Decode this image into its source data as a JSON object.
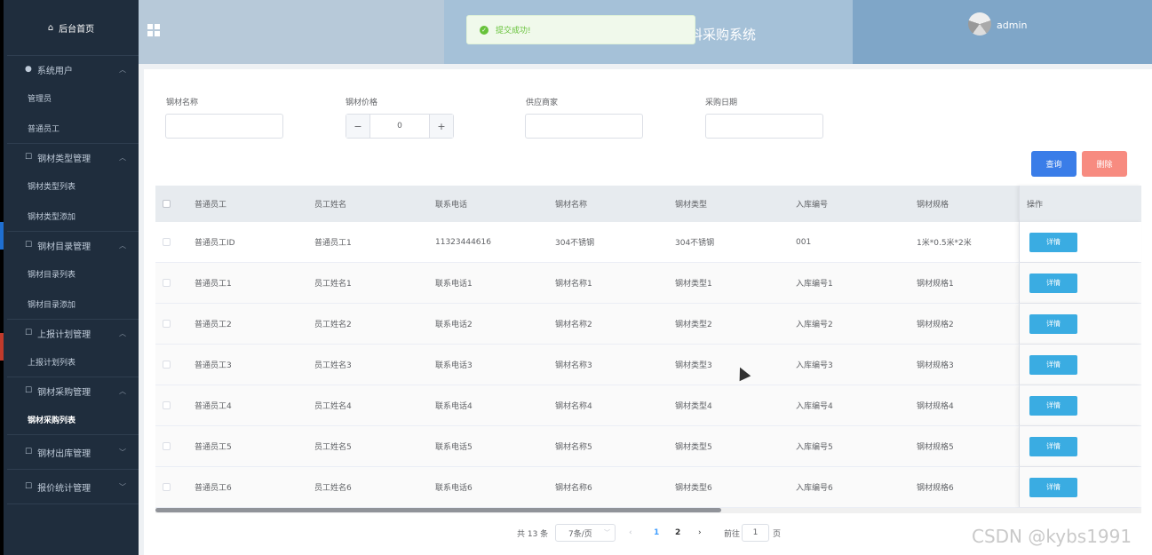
{
  "sidebar": {
    "home": "后台首页",
    "groups": [
      {
        "label": "系统用户",
        "items": [
          "管理员",
          "普通员工"
        ]
      },
      {
        "label": "钢材类型管理",
        "items": [
          "钢材类型列表",
          "钢材类型添加"
        ]
      },
      {
        "label": "钢材目录管理",
        "items": [
          "钢材目录列表",
          "钢材目录添加"
        ]
      },
      {
        "label": "上报计划管理",
        "items": [
          "上报计划列表"
        ]
      },
      {
        "label": "钢材采购管理",
        "items": [
          "钢材采购列表"
        ]
      },
      {
        "label": "钢材出库管理",
        "items": []
      },
      {
        "label": "报价统计管理",
        "items": []
      }
    ]
  },
  "header": {
    "title": "料采购系统",
    "username": "admin"
  },
  "toast": {
    "message": "提交成功!",
    "type": "success"
  },
  "filters": {
    "name_label": "钢材名称",
    "name_value": "",
    "price_label": "钢材价格",
    "price_value": "0",
    "supplier_label": "供应商家",
    "supplier_value": "",
    "date_label": "采购日期",
    "date_value": ""
  },
  "actions": {
    "query": "查询",
    "delete": "删除"
  },
  "table": {
    "columns": [
      "普通员工",
      "员工姓名",
      "联系电话",
      "钢材名称",
      "钢材类型",
      "入库编号",
      "钢材规格",
      "操作"
    ],
    "detail_label": "详情",
    "rows": [
      [
        "普通员工ID",
        "普通员工1",
        "11323444616",
        "304不锈钢",
        "304不锈钢",
        "001",
        "1米*0.5米*2米"
      ],
      [
        "普通员工1",
        "员工姓名1",
        "联系电话1",
        "钢材名称1",
        "钢材类型1",
        "入库编号1",
        "钢材规格1"
      ],
      [
        "普通员工2",
        "员工姓名2",
        "联系电话2",
        "钢材名称2",
        "钢材类型2",
        "入库编号2",
        "钢材规格2"
      ],
      [
        "普通员工3",
        "员工姓名3",
        "联系电话3",
        "钢材名称3",
        "钢材类型3",
        "入库编号3",
        "钢材规格3"
      ],
      [
        "普通员工4",
        "员工姓名4",
        "联系电话4",
        "钢材名称4",
        "钢材类型4",
        "入库编号4",
        "钢材规格4"
      ],
      [
        "普通员工5",
        "员工姓名5",
        "联系电话5",
        "钢材名称5",
        "钢材类型5",
        "入库编号5",
        "钢材规格5"
      ],
      [
        "普通员工6",
        "员工姓名6",
        "联系电话6",
        "钢材名称6",
        "钢材类型6",
        "入库编号6",
        "钢材规格6"
      ]
    ]
  },
  "pagination": {
    "total": "共 13 条",
    "page_size": "7条/页",
    "pages": [
      "1",
      "2"
    ],
    "current_page": "1",
    "goto_label": "前往",
    "goto_value": "1",
    "page_unit": "页"
  },
  "watermark": "CSDN @kybs1991",
  "colors": {
    "sidebar_bg": "#1f2d3d",
    "header_bg": "#b7c9d9",
    "primary": "#3a7de8",
    "danger": "#f78b80",
    "detail": "#3aace2",
    "success": "#67c23a"
  },
  "icons": [
    "home-icon",
    "user-icon",
    "doc-icon",
    "chevron-up-icon",
    "chevron-down-icon",
    "grid-icon",
    "avatar-icon",
    "success-icon",
    "minus-icon",
    "plus-icon"
  ]
}
